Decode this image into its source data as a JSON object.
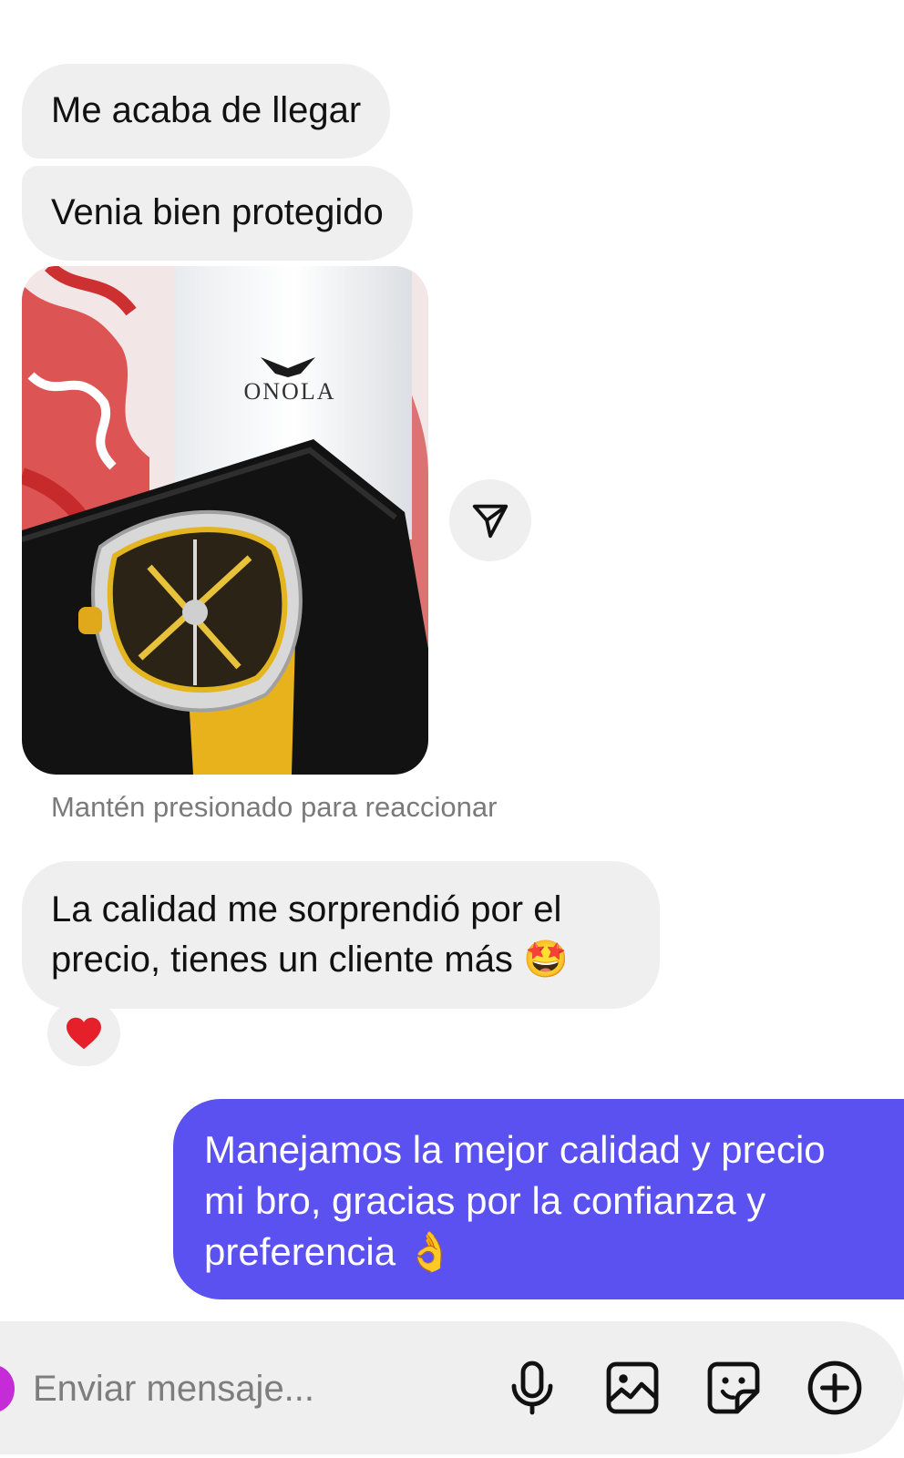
{
  "messages": {
    "received_1": "Me acaba de llegar",
    "received_2": "Venia bien protegido",
    "received_3": "La calidad me sorprendió por el\nprecio, tienes un cliente más 🤩",
    "sent_1": "Manejamos la mejor calidad y precio\nmi bro, gracias por la confianza y\npreferencia 👌"
  },
  "photo": {
    "brand_text": "ONOLA",
    "icon": "watch-photo"
  },
  "hint": "Mantén presionado para reaccionar",
  "reaction": {
    "emoji": "❤️"
  },
  "composer": {
    "placeholder": "Enviar mensaje..."
  },
  "icons": {
    "share": "paper-plane-icon",
    "mic": "microphone-icon",
    "gallery": "image-icon",
    "sticker": "sticker-icon",
    "plus": "plus-circle-icon"
  },
  "colors": {
    "sent_bubble": "#5b51f0",
    "received_bubble": "#efefef",
    "avatar": "#c52bd6"
  }
}
